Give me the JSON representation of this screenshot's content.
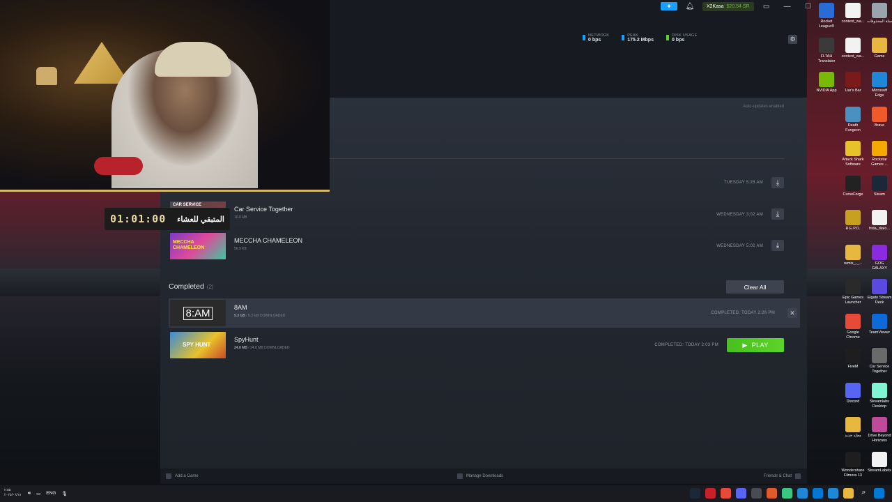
{
  "titlebar": {
    "account_name": "X2Kasa",
    "account_balance": "$20.54 SR"
  },
  "stats": [
    {
      "label": "NETWORK",
      "value": "0 bps",
      "color": "#1a9fff"
    },
    {
      "label": "PEAK",
      "value": "175.2 Mbps",
      "color": "#1a9fff"
    },
    {
      "label": "DISK USAGE",
      "value": "0 bps",
      "color": "#5cd42a"
    }
  ],
  "auto_updates": "Auto-updates enabled",
  "scheduled": [
    {
      "name": "",
      "when": "TUESDAY 5:28 AM"
    },
    {
      "name": "Car Service Together",
      "size": "10.8 MB",
      "when": "WEDNESDAY 3:02 AM",
      "thumb_text": "CAR SERVICE"
    },
    {
      "name": "MECCHA CHAMELEON",
      "size": "56.9 KB",
      "when": "WEDNESDAY 5:02 AM",
      "thumb_text": "MECCHA CHAMELEON"
    }
  ],
  "completed_section": {
    "title": "Completed",
    "count": "(2)",
    "clear_all": "Clear All"
  },
  "completed": [
    {
      "name": "8AM",
      "size_done": "5.3 GB",
      "size_total": "/ 5.3 GB DOWNLOADED",
      "when": "COMPLETED: TODAY 2:26 PM",
      "thumb_text": "8:AM"
    },
    {
      "name": "SpyHunt",
      "size_done": "24.8 MB",
      "size_total": "/ 24.8 MB DOWNLOADED",
      "when": "COMPLETED: TODAY 2:03 PM",
      "play": "PLAY",
      "thumb_text": "SPY HUNT"
    }
  ],
  "bottombar": {
    "add_game": "Add a Game",
    "manage_downloads": "Manage Downloads",
    "friends_chat": "Friends & Chat"
  },
  "overlay": {
    "timer": "01:01:00",
    "arabic_label": "المتبقي للعشاء"
  },
  "desktop_icons": [
    {
      "label": "Rocket League®",
      "color": "#2a6cd6"
    },
    {
      "label": "content_wa...",
      "color": "#f2f2f2"
    },
    {
      "label": "سلة المحذوفات",
      "color": "#9aa4ad"
    },
    {
      "label": "FLTAH Translator",
      "color": "#3a3a3a"
    },
    {
      "label": "content_wa...",
      "color": "#f2f2f2"
    },
    {
      "label": "Game",
      "color": "#e8b740"
    },
    {
      "label": "NVIDIA App",
      "color": "#76b900"
    },
    {
      "label": "Liar's Bar",
      "color": "#7a1a1a"
    },
    {
      "label": "Microsoft Edge",
      "color": "#1e88d6"
    },
    {
      "label": "Death Fungeon",
      "color": "#4a90c0"
    },
    {
      "label": "Brave",
      "color": "#f05a2a"
    },
    {
      "label": "Attack Shark Software",
      "color": "#e8c22a"
    },
    {
      "label": "Rockstar Games ...",
      "color": "#f2a900"
    },
    {
      "label": "CurseForge",
      "color": "#222222"
    },
    {
      "label": "Steam",
      "color": "#1b2838"
    },
    {
      "label": "R.E.P.O.",
      "color": "#c8a020"
    },
    {
      "label": "frida_dialo...",
      "color": "#f2f2f2"
    },
    {
      "label": "remix_-_...",
      "color": "#e8b740"
    },
    {
      "label": "GOG GALAXY",
      "color": "#8a2be2"
    },
    {
      "label": "Epic Games Launcher",
      "color": "#2a2a2a"
    },
    {
      "label": "Elgato Stream Deck",
      "color": "#5a4adf"
    },
    {
      "label": "Google Chrome",
      "color": "#e84a3a"
    },
    {
      "label": "TeamViewer",
      "color": "#0e6ad9"
    },
    {
      "label": "FiveM",
      "color": "#1e1e1e"
    },
    {
      "label": "Car Service Together",
      "color": "#6a6a6a"
    },
    {
      "label": "Discord",
      "color": "#5865f2"
    },
    {
      "label": "Streamlabs Desktop",
      "color": "#80f5d2"
    },
    {
      "label": "مجلد جديد",
      "color": "#e8b740"
    },
    {
      "label": "Drive Beyond Horizons",
      "color": "#c04a9a"
    },
    {
      "label": "Wondershare Filmora 13",
      "color": "#1e1e1e"
    },
    {
      "label": "StreamLabels",
      "color": "#f2f2f2"
    }
  ],
  "taskbar": {
    "time": "٢:٥٥",
    "date": "٢٠٢٥/٠٦/١٨",
    "lang": "ENG"
  }
}
